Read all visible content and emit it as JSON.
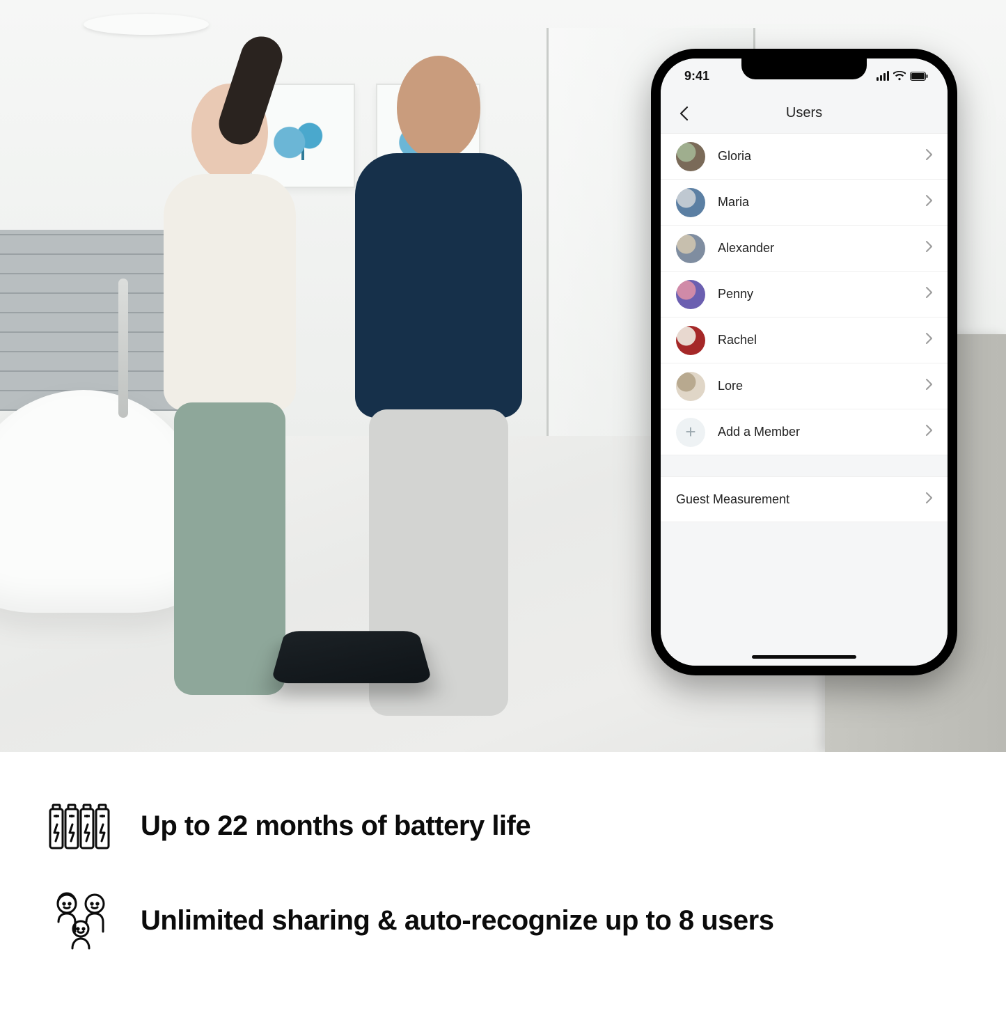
{
  "phone": {
    "status_time": "9:41",
    "header_title": "Users",
    "users": [
      {
        "name": "Gloria",
        "avatar_color_a": "#7a6a58",
        "avatar_color_b": "#9fae8e"
      },
      {
        "name": "Maria",
        "avatar_color_a": "#5b7fa3",
        "avatar_color_b": "#bfc8d1"
      },
      {
        "name": "Alexander",
        "avatar_color_a": "#7f8da0",
        "avatar_color_b": "#c7bfae"
      },
      {
        "name": "Penny",
        "avatar_color_a": "#6b5fb0",
        "avatar_color_b": "#d08aa8"
      },
      {
        "name": "Rachel",
        "avatar_color_a": "#a52828",
        "avatar_color_b": "#e8d8cf"
      },
      {
        "name": "Lore",
        "avatar_color_a": "#e0d6c7",
        "avatar_color_b": "#b8a98f"
      }
    ],
    "add_member_label": "Add a Member",
    "guest_label": "Guest Measurement"
  },
  "features": {
    "battery": "Up to 22 months of battery life",
    "sharing": "Unlimited sharing & auto-recognize up to 8 users"
  }
}
